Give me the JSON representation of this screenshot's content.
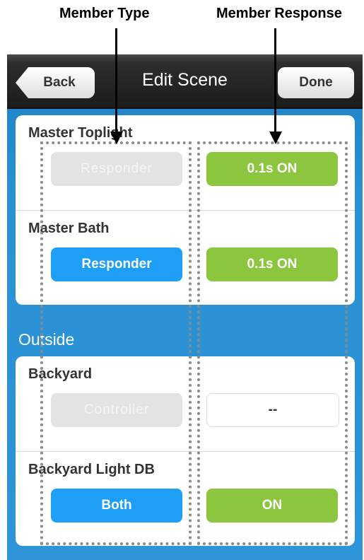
{
  "annotations": {
    "member_type_label": "Member Type",
    "member_response_label": "Member Response"
  },
  "navbar": {
    "back_label": "Back",
    "title": "Edit Scene",
    "done_label": "Done"
  },
  "sections": [
    {
      "header": "",
      "members": [
        {
          "name": "Master Toplight",
          "type": "Responder",
          "type_state": "disabled",
          "response": "0.1s  ON",
          "response_style": "green"
        },
        {
          "name": "Master Bath",
          "type": "Responder",
          "type_state": "active",
          "response": "0.1s  ON",
          "response_style": "green"
        }
      ]
    },
    {
      "header": "Outside",
      "members": [
        {
          "name": "Backyard",
          "type": "Controller",
          "type_state": "disabled",
          "response": "--",
          "response_style": "empty"
        },
        {
          "name": "Backyard Light DB",
          "type": "Both",
          "type_state": "active",
          "response": "ON",
          "response_style": "green"
        }
      ]
    }
  ],
  "colors": {
    "blue_button": "#1e9ef5",
    "green_button": "#8cc63f",
    "background": "#2b90d4"
  }
}
